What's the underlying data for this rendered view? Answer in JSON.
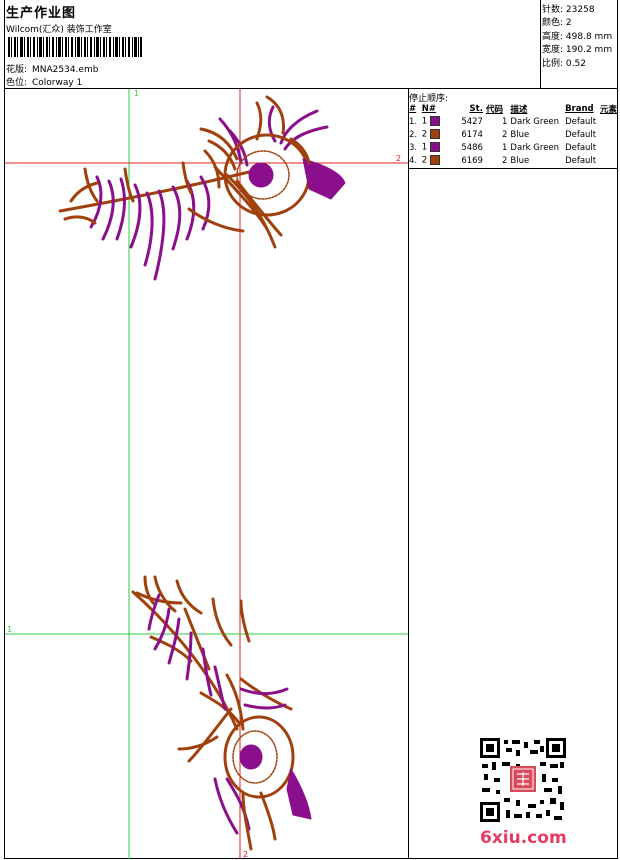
{
  "header": {
    "title": "生产作业图",
    "company": "Wilcom(汇众) 装饰工作室",
    "pattern_label": "花版:",
    "pattern_value": "MNA2534.emb",
    "colorway_label": "色位:",
    "colorway_value": "Colorway 1"
  },
  "stats": [
    {
      "label": "针数:",
      "value": "23258"
    },
    {
      "label": "颜色:",
      "value": "2"
    },
    {
      "label": "高度:",
      "value": "498.8 mm"
    },
    {
      "label": "宽度:",
      "value": "190.2 mm"
    },
    {
      "label": "比例:",
      "value": "0.52"
    }
  ],
  "stop_sequence": {
    "title": "停止顺序:",
    "headers": [
      "#",
      "N#",
      "St.",
      "代码",
      "描述",
      "Brand",
      "元素"
    ],
    "rows": [
      {
        "idx": "1.",
        "n": "1",
        "color": "#8b0f8c",
        "st": "5427",
        "code": "1",
        "desc": "Dark Green",
        "brand": "Default"
      },
      {
        "idx": "2.",
        "n": "2",
        "color": "#a0410d",
        "st": "6174",
        "code": "2",
        "desc": "Blue",
        "brand": "Default"
      },
      {
        "idx": "3.",
        "n": "1",
        "color": "#8b0f8c",
        "st": "5486",
        "code": "1",
        "desc": "Dark Green",
        "brand": "Default"
      },
      {
        "idx": "4.",
        "n": "2",
        "color": "#a0410d",
        "st": "6169",
        "code": "2",
        "desc": "Blue",
        "brand": "Default"
      }
    ]
  },
  "markers": {
    "top_green": "1",
    "right_red": "2",
    "left_green": "1",
    "bottom_red": "2"
  },
  "colors": {
    "purple": "#8b0f8c",
    "brown": "#a0410d",
    "guide_green": "#2ecc40",
    "guide_red": "#e02020",
    "watermark": "#e83a64"
  },
  "watermark": "6xiu.com",
  "qr_stamp_icon": "qr-code-icon"
}
